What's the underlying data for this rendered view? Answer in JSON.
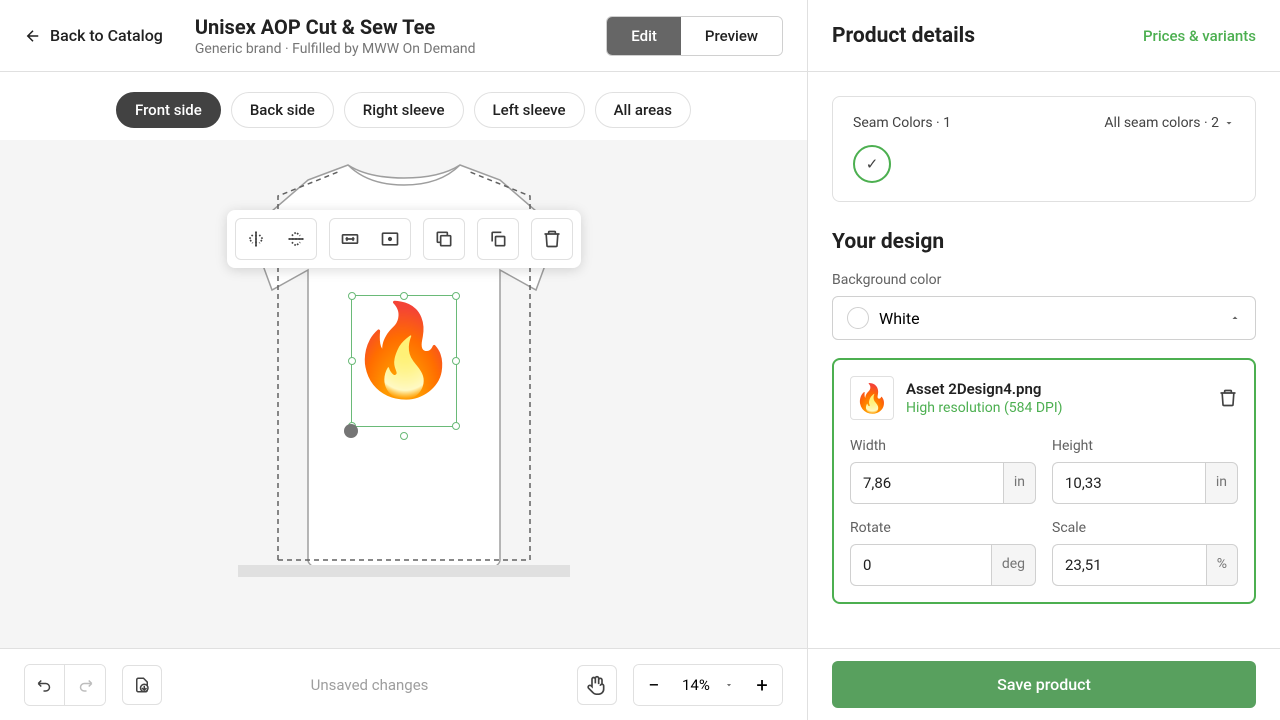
{
  "header": {
    "back_label": "Back to Catalog",
    "title": "Unisex AOP Cut & Sew Tee",
    "subtitle": "Generic brand · Fulfilled by MWW On Demand",
    "edit_label": "Edit",
    "preview_label": "Preview"
  },
  "tabs": {
    "front": "Front side",
    "back": "Back side",
    "right_sleeve": "Right sleeve",
    "left_sleeve": "Left sleeve",
    "all": "All areas"
  },
  "canvas": {
    "zoom": "14%",
    "status": "Unsaved changes"
  },
  "right": {
    "title": "Product details",
    "link": "Prices & variants",
    "seam": {
      "label": "Seam Colors · 1",
      "dropdown": "All seam colors · 2"
    },
    "design_title": "Your design",
    "bg_label": "Background color",
    "bg_value": "White",
    "asset": {
      "name": "Asset 2Design4.png",
      "dpi": "High resolution (584 DPI)",
      "width_label": "Width",
      "width_val": "7,86",
      "width_unit": "in",
      "height_label": "Height",
      "height_val": "10,33",
      "height_unit": "in",
      "rotate_label": "Rotate",
      "rotate_val": "0",
      "rotate_unit": "deg",
      "scale_label": "Scale",
      "scale_val": "23,51",
      "scale_unit": "%"
    },
    "save_label": "Save product"
  }
}
